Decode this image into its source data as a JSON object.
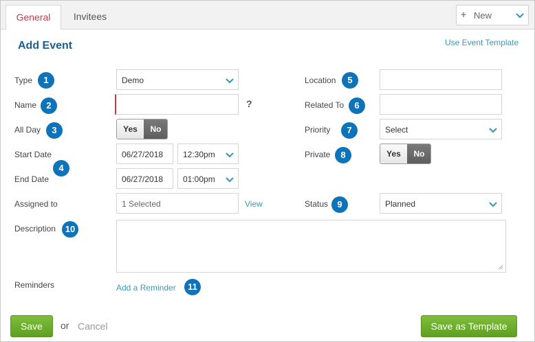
{
  "tabs": [
    {
      "label": "General"
    },
    {
      "label": "Invitees"
    }
  ],
  "new_button": {
    "label": "New"
  },
  "header": {
    "title": "Add Event",
    "template_link": "Use Event Template"
  },
  "form": {
    "type": {
      "label": "Type",
      "value": "Demo",
      "badge": "1"
    },
    "name": {
      "label": "Name",
      "value": "",
      "badge": "2",
      "help": "?"
    },
    "all_day": {
      "label": "All Day",
      "badge": "3",
      "yes": "Yes",
      "no": "No",
      "selected": "No"
    },
    "start_date": {
      "label": "Start Date",
      "date": "06/27/2018",
      "time": "12:30pm"
    },
    "end_date": {
      "label": "End Date",
      "date": "06/27/2018",
      "time": "01:00pm"
    },
    "dates_badge": "4",
    "assigned_to": {
      "label": "Assigned to",
      "value": "1 Selected",
      "view_link": "View"
    },
    "description": {
      "label": "Description",
      "badge": "10",
      "value": ""
    },
    "reminders": {
      "label": "Reminders",
      "link": "Add a Reminder",
      "badge": "11"
    },
    "location": {
      "label": "Location",
      "badge": "5",
      "value": ""
    },
    "related_to": {
      "label": "Related To",
      "badge": "6",
      "value": ""
    },
    "priority": {
      "label": "Priority",
      "badge": "7",
      "value": "Select"
    },
    "private": {
      "label": "Private",
      "badge": "8",
      "yes": "Yes",
      "no": "No",
      "selected": "No"
    },
    "status": {
      "label": "Status",
      "badge": "9",
      "value": "Planned"
    }
  },
  "footer": {
    "save": "Save",
    "or": "or",
    "cancel": "Cancel",
    "save_template": "Save as Template"
  },
  "colors": {
    "accent": "#0e73b8",
    "link": "#3a9ab8",
    "title": "#1a5e8f",
    "save_green": "#6aab2a",
    "active_tab": "#d2334b"
  }
}
